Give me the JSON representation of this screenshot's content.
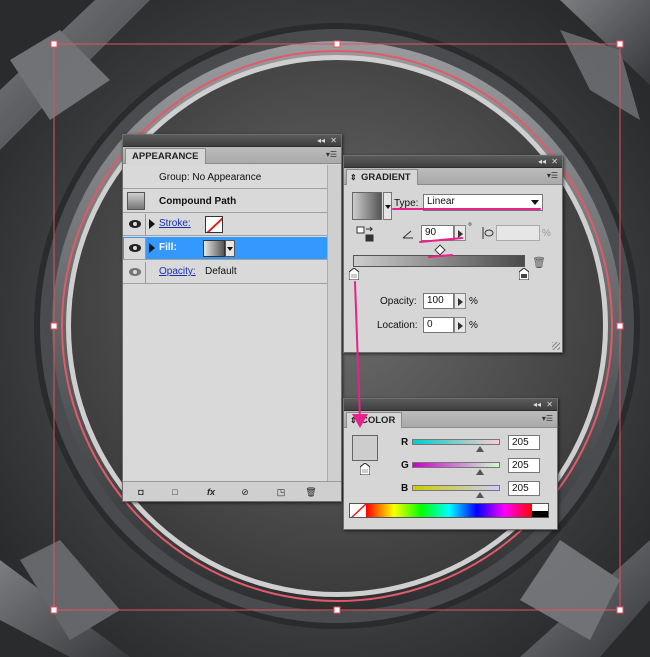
{
  "appearance": {
    "tab_label": "APPEARANCE",
    "header_text": "Group: No Appearance",
    "compound_label": "Compound Path",
    "stroke_label": "Stroke:",
    "fill_label": "Fill:",
    "opacity_label": "Opacity:",
    "opacity_value": "Default",
    "footer_fx_label": "fx"
  },
  "gradient": {
    "tab_label": "GRADIENT",
    "type_label": "Type:",
    "type_value": "Linear",
    "angle_value": "90",
    "degree_symbol": "°",
    "aspect_percent": "%",
    "opacity_label": "Opacity:",
    "opacity_value": "100",
    "location_label": "Location:",
    "location_value": "0",
    "percent": "%"
  },
  "color": {
    "tab_label": "COLOR",
    "r_label": "R",
    "g_label": "G",
    "b_label": "B",
    "r_value": "205",
    "g_value": "205",
    "b_value": "205"
  },
  "colors": {
    "selection_blue": "#3399ff",
    "annotation_pink": "#e8228a",
    "bounding_red": "#e85060",
    "panel_gray": "#d6d6d6",
    "swatch_gray": "#cdcdcd"
  }
}
